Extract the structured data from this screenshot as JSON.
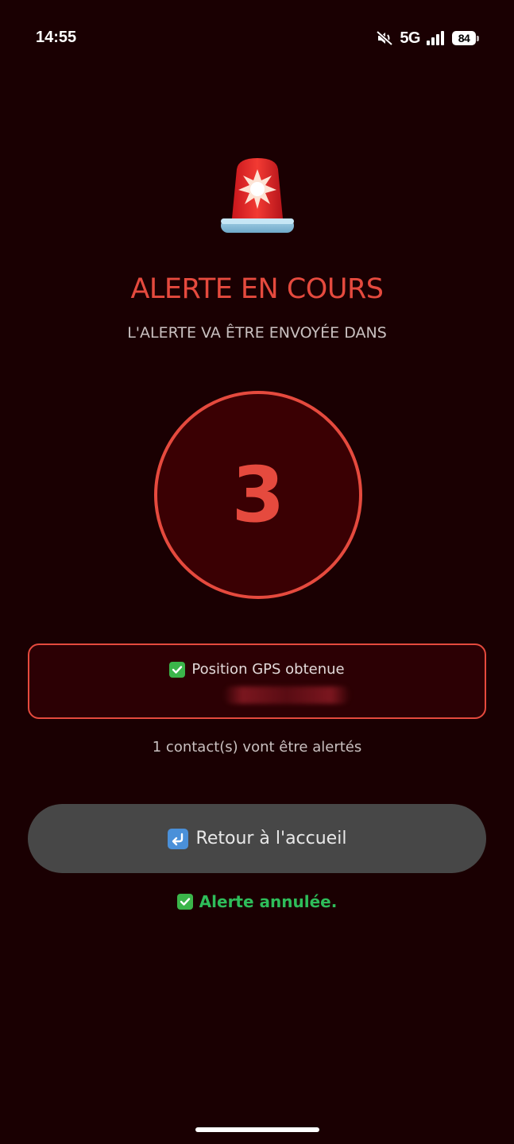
{
  "status_bar": {
    "time": "14:55",
    "network": "5G",
    "battery": "84",
    "icons": [
      "mute-icon",
      "signal-icon",
      "battery-icon"
    ]
  },
  "alert": {
    "icon": "siren-icon",
    "title": "ALERTE EN COURS",
    "subtitle": "L'ALERTE VA ÊTRE ENVOYÉE DANS",
    "countdown": "3"
  },
  "gps": {
    "status_icon": "check-icon",
    "status_text": "Position GPS obtenue"
  },
  "contacts_info": "1 contact(s) vont être alertés",
  "home_button": {
    "icon": "return-arrow-icon",
    "label": "Retour à l'accueil"
  },
  "cancel_message": {
    "icon": "check-icon",
    "text": "Alerte annulée."
  },
  "colors": {
    "background": "#1a0002",
    "accent_red": "#e54a3e",
    "success_green": "#2ebd5a",
    "button_gray": "#474747"
  }
}
